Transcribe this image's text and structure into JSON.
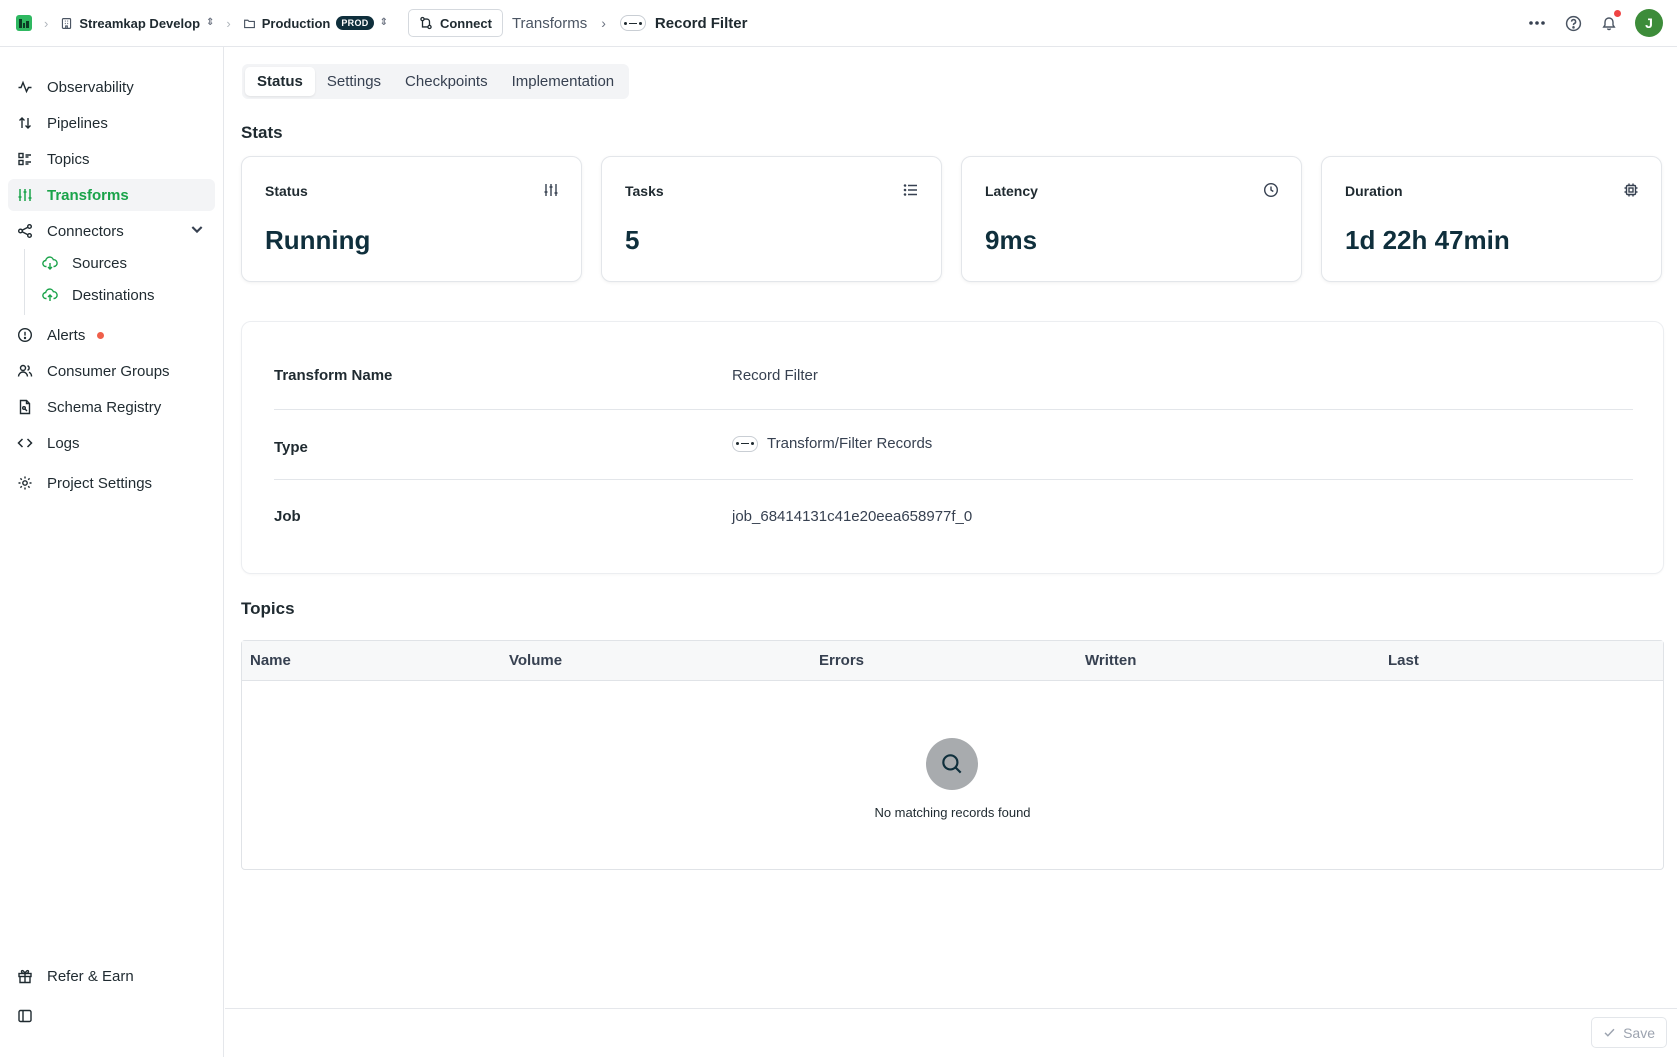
{
  "topbar": {
    "org_name": "Streamkap Develop",
    "env_name": "Production",
    "env_badge": "PROD",
    "connect_label": "Connect",
    "breadcrumb_parent": "Transforms",
    "breadcrumb_current": "Record Filter",
    "avatar_initial": "J"
  },
  "sidebar": {
    "items": [
      {
        "label": "Observability",
        "icon": "activity-icon"
      },
      {
        "label": "Pipelines",
        "icon": "arrows-up-down-icon"
      },
      {
        "label": "Topics",
        "icon": "list-grid-icon"
      },
      {
        "label": "Transforms",
        "icon": "sliders-icon",
        "active": true
      },
      {
        "label": "Connectors",
        "icon": "share-nodes-icon",
        "expanded": true
      },
      {
        "label": "Alerts",
        "icon": "alert-circle-icon",
        "has_dot": true
      },
      {
        "label": "Consumer Groups",
        "icon": "users-icon"
      },
      {
        "label": "Schema Registry",
        "icon": "file-schema-icon"
      },
      {
        "label": "Logs",
        "icon": "code-icon"
      },
      {
        "label": "Project Settings",
        "icon": "gear-icon"
      }
    ],
    "sub_items": [
      {
        "label": "Sources",
        "icon": "cloud-download-icon"
      },
      {
        "label": "Destinations",
        "icon": "cloud-upload-icon"
      }
    ],
    "footer_item": {
      "label": "Refer & Earn",
      "icon": "gift-icon"
    }
  },
  "tabs": [
    {
      "label": "Status",
      "active": true
    },
    {
      "label": "Settings"
    },
    {
      "label": "Checkpoints"
    },
    {
      "label": "Implementation"
    }
  ],
  "stats": {
    "title": "Stats",
    "cards": [
      {
        "label": "Status",
        "value": "Running",
        "icon": "sliders-icon"
      },
      {
        "label": "Tasks",
        "value": "5",
        "icon": "list-icon"
      },
      {
        "label": "Latency",
        "value": "9ms",
        "icon": "clock-icon"
      },
      {
        "label": "Duration",
        "value": "1d 22h 47min",
        "icon": "cpu-icon"
      }
    ]
  },
  "details": {
    "rows": [
      {
        "key": "Transform Name",
        "value": "Record Filter"
      },
      {
        "key": "Type",
        "value": "Transform/Filter Records"
      },
      {
        "key": "Job",
        "value": "job_68414131c41e20eea658977f_0"
      }
    ]
  },
  "topics": {
    "title": "Topics",
    "columns": [
      "Name",
      "Volume",
      "Errors",
      "Written",
      "Last"
    ],
    "empty_text": "No matching records found"
  },
  "footer": {
    "save_label": "Save"
  },
  "colors": {
    "accent": "#1aa34a",
    "brand_dark": "#0f2f3c",
    "alert": "#ef5f4a"
  }
}
